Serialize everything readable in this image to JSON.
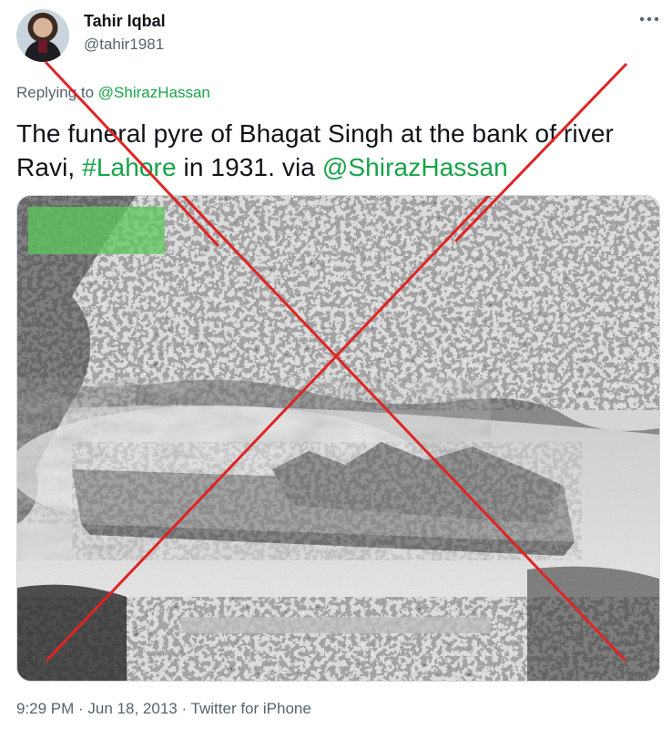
{
  "author": {
    "display_name": "Tahir Iqbal",
    "handle": "@tahir1981",
    "avatar_icon": "user-avatar"
  },
  "more_icon": "more-horizontal-icon",
  "reply": {
    "prefix": "Replying to",
    "mention": "@ShirazHassan"
  },
  "tweet": {
    "text_part1": "The funeral pyre of Bhagat Singh at the bank of river Ravi, ",
    "hashtag": "#Lahore",
    "text_part2": " in 1931.  via ",
    "mention": "@ShirazHassan"
  },
  "photo": {
    "overlay_mark": "red-cross-mark",
    "colors": {
      "cross": "#e02424",
      "watermark": "#5cc95c"
    }
  },
  "meta": {
    "time": "9:29 PM",
    "separator1": " · ",
    "date": "Jun 18, 2013",
    "separator2": " · ",
    "source": "Twitter for iPhone"
  },
  "colors": {
    "link": "#17a34a",
    "secondary": "#536471",
    "primary": "#0f1419"
  }
}
